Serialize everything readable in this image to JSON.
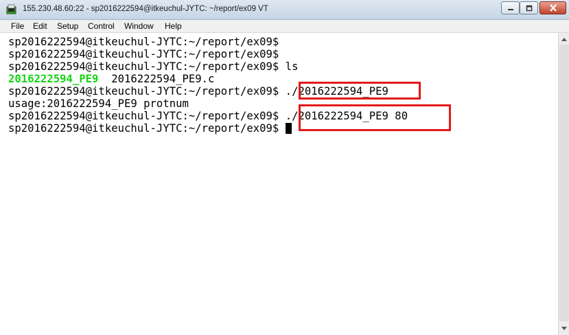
{
  "window": {
    "title": "155.230.48.60:22 - sp2016222594@itkeuchul-JYTC: ~/report/ex09 VT"
  },
  "menu": [
    "File",
    "Edit",
    "Setup",
    "Control",
    "Window",
    "Help"
  ],
  "terminal": {
    "prompt": "sp2016222594@itkeuchul-JYTC:~/report/ex09$",
    "commands": {
      "ls": "ls",
      "run": "./2016222594_PE9",
      "run_with_port": "./2016222594_PE9 80"
    },
    "ls_output": {
      "executable": "2016222594_PE9",
      "source": "2016222594_PE9.c"
    },
    "usage_message": "usage:2016222594_PE9 protnum"
  },
  "colors": {
    "executable": "#14d614",
    "highlight_box": "#e31818"
  },
  "icons": [
    "terminal-app-icon",
    "minimize-icon",
    "maximize-icon",
    "close-icon",
    "scroll-up-icon",
    "scroll-down-icon"
  ]
}
